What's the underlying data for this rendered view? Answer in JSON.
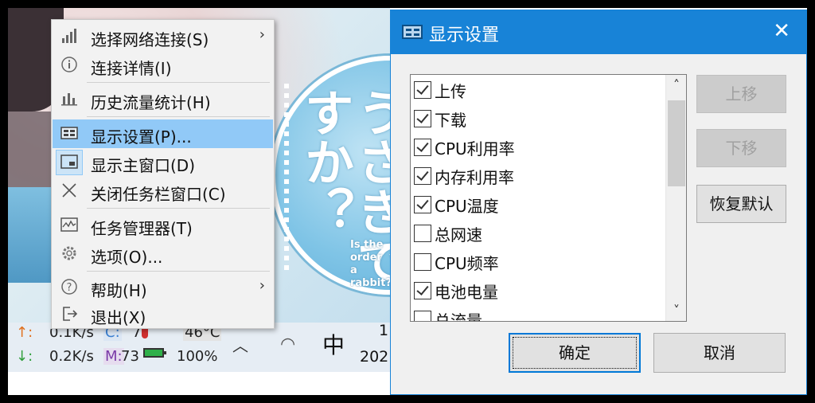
{
  "desktop": {
    "wallpaper_kana": "うさぎですか？",
    "wallpaper_en": [
      "Is the",
      "order",
      "a rabbit?"
    ]
  },
  "taskbar": {
    "up_arrow": "↑:",
    "down_arrow": "↓:",
    "upload_speed": "0.1K/s",
    "download_speed": "0.2K/s",
    "cpu_label": "C:",
    "cpu_value": "7",
    "temp_value": "46°C",
    "mem_label": "M:",
    "mem_value": "73",
    "battery_value": "100%",
    "ime": "中",
    "clock_line1": "1",
    "clock_line2": "202"
  },
  "context_menu": {
    "items": [
      {
        "label": "选择网络连接(S)",
        "submenu": "›"
      },
      {
        "label": "连接详情(I)"
      },
      {
        "label": "历史流量统计(H)"
      },
      {
        "label": "显示设置(P)..."
      },
      {
        "label": "显示主窗口(D)"
      },
      {
        "label": "关闭任务栏窗口(C)"
      },
      {
        "label": "任务管理器(T)"
      },
      {
        "label": "选项(O)..."
      },
      {
        "label": "帮助(H)",
        "submenu": "›"
      },
      {
        "label": "退出(X)"
      }
    ]
  },
  "dialog": {
    "title": "显示设置",
    "close": "✕",
    "list_items": [
      {
        "label": "上传",
        "checked": true
      },
      {
        "label": "下载",
        "checked": true
      },
      {
        "label": "CPU利用率",
        "checked": true
      },
      {
        "label": "内存利用率",
        "checked": true
      },
      {
        "label": "CPU温度",
        "checked": true
      },
      {
        "label": "总网速",
        "checked": false
      },
      {
        "label": "CPU频率",
        "checked": false
      },
      {
        "label": "电池电量",
        "checked": true
      },
      {
        "label": "总流量",
        "checked": false
      }
    ],
    "scroll_up": "˄",
    "scroll_down": "˅",
    "move_up_label": "上移",
    "move_down_label": "下移",
    "restore_default_label": "恢复默认",
    "ok_label": "确定",
    "cancel_label": "取消"
  }
}
